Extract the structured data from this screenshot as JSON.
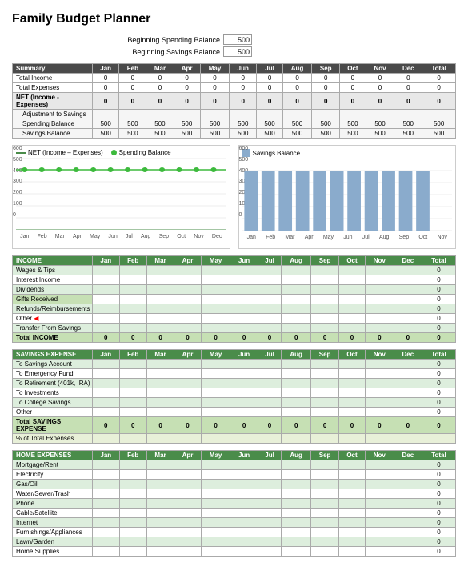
{
  "title": "Family Budget Planner",
  "balances": {
    "spending_label": "Beginning Spending Balance",
    "spending_value": "500",
    "savings_label": "Beginning Savings Balance",
    "savings_value": "500"
  },
  "summary": {
    "header": [
      "Summary",
      "Jan",
      "Feb",
      "Mar",
      "Apr",
      "May",
      "Jun",
      "Jul",
      "Aug",
      "Sep",
      "Oct",
      "Nov",
      "Dec",
      "Total"
    ],
    "rows": [
      {
        "label": "Total Income",
        "values": [
          "0",
          "0",
          "0",
          "0",
          "0",
          "0",
          "0",
          "0",
          "0",
          "0",
          "0",
          "0",
          "0"
        ]
      },
      {
        "label": "Total Expenses",
        "values": [
          "0",
          "0",
          "0",
          "0",
          "0",
          "0",
          "0",
          "0",
          "0",
          "0",
          "0",
          "0",
          "0"
        ]
      },
      {
        "label": "NET (Income - Expenses)",
        "values": [
          "0",
          "0",
          "0",
          "0",
          "0",
          "0",
          "0",
          "0",
          "0",
          "0",
          "0",
          "0",
          "0"
        ],
        "bold": true
      },
      {
        "label": "  Adjustment to Savings",
        "values": [
          "",
          "",
          "",
          "",
          "",
          "",
          "",
          "",
          "",
          "",
          "",
          "",
          ""
        ]
      },
      {
        "label": "  Spending Balance",
        "values": [
          "500",
          "500",
          "500",
          "500",
          "500",
          "500",
          "500",
          "500",
          "500",
          "500",
          "500",
          "500",
          "500"
        ]
      },
      {
        "label": "  Savings Balance",
        "values": [
          "500",
          "500",
          "500",
          "500",
          "500",
          "500",
          "500",
          "500",
          "500",
          "500",
          "500",
          "500",
          "500"
        ]
      }
    ]
  },
  "charts": {
    "left": {
      "title_line1": "NET (Income - Expenses)",
      "title_line2": "Spending Balance",
      "y_labels": [
        "600",
        "500",
        "400",
        "300",
        "200",
        "100",
        "0"
      ],
      "x_labels": [
        "Jan",
        "Feb",
        "Mar",
        "Apr",
        "May",
        "Jun",
        "Jul",
        "Aug",
        "Sep",
        "Oct",
        "Nov",
        "Dec"
      ],
      "spending_value": 500
    },
    "right": {
      "title": "Savings Balance",
      "y_labels": [
        "600",
        "500",
        "400",
        "300",
        "200",
        "100",
        "0"
      ],
      "x_labels": [
        "Jan",
        "Feb",
        "Mar",
        "Apr",
        "May",
        "Jun",
        "Jul",
        "Aug",
        "Sep",
        "Oct",
        "Nov"
      ],
      "bar_value": 500
    }
  },
  "income": {
    "header": [
      "INCOME",
      "Jan",
      "Feb",
      "Mar",
      "Apr",
      "May",
      "Jun",
      "Jul",
      "Aug",
      "Sep",
      "Oct",
      "Nov",
      "Dec",
      "Total"
    ],
    "rows": [
      {
        "label": "Wages & Tips"
      },
      {
        "label": "Interest Income"
      },
      {
        "label": "Dividends"
      },
      {
        "label": "Gifts Received"
      },
      {
        "label": "Refunds/Reimbursements"
      },
      {
        "label": "Other"
      },
      {
        "label": "Transfer From Savings"
      }
    ],
    "total_label": "Total INCOME",
    "total_values": [
      "0",
      "0",
      "0",
      "0",
      "0",
      "0",
      "0",
      "0",
      "0",
      "0",
      "0",
      "0",
      "0"
    ]
  },
  "savings": {
    "header": [
      "SAVINGS EXPENSE",
      "Jan",
      "Feb",
      "Mar",
      "Apr",
      "May",
      "Jun",
      "Jul",
      "Aug",
      "Sep",
      "Oct",
      "Nov",
      "Dec",
      "Total"
    ],
    "rows": [
      {
        "label": "To Savings Account"
      },
      {
        "label": "To Emergency Fund"
      },
      {
        "label": "To Retirement (401k, IRA)"
      },
      {
        "label": "To Investments"
      },
      {
        "label": "To College Savings"
      },
      {
        "label": "Other"
      }
    ],
    "total_label": "Total SAVINGS EXPENSE",
    "total_values": [
      "0",
      "0",
      "0",
      "0",
      "0",
      "0",
      "0",
      "0",
      "0",
      "0",
      "0",
      "0",
      "0"
    ],
    "pct_label": "% of Total Expenses",
    "pct_values": [
      "",
      "",
      "",
      "",
      "",
      "",
      "",
      "",
      "",
      "",
      "",
      "",
      ""
    ]
  },
  "home": {
    "header": [
      "HOME EXPENSES",
      "Jan",
      "Feb",
      "Mar",
      "Apr",
      "May",
      "Jun",
      "Jul",
      "Aug",
      "Sep",
      "Oct",
      "Nov",
      "Dec",
      "Total"
    ],
    "rows": [
      {
        "label": "Mortgage/Rent"
      },
      {
        "label": "Electricity"
      },
      {
        "label": "Gas/Oil"
      },
      {
        "label": "Water/Sewer/Trash"
      },
      {
        "label": "Phone"
      },
      {
        "label": "Cable/Satellite"
      },
      {
        "label": "Internet"
      },
      {
        "label": "Furnishings/Appliances"
      },
      {
        "label": "Lawn/Garden"
      },
      {
        "label": "Home Supplies"
      }
    ]
  },
  "zero": "0",
  "empty": ""
}
